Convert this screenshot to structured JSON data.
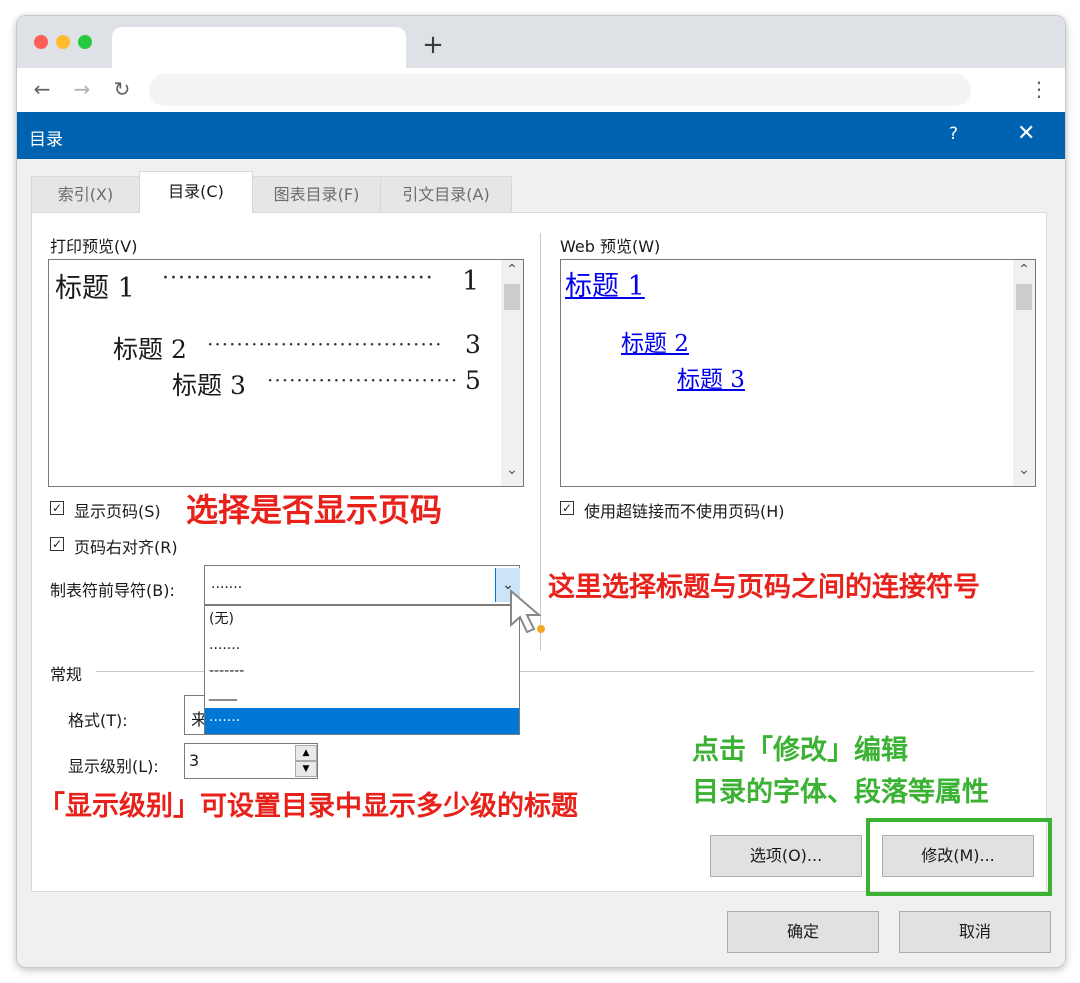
{
  "browser": {
    "new_tab_icon": "+",
    "back_icon": "←",
    "forward_icon": "→",
    "reload_icon": "↻",
    "menu_icon": "⋮"
  },
  "dialog": {
    "title": "目录",
    "help": "?",
    "close": "✕",
    "tabs": [
      "索引(X)",
      "目录(C)",
      "图表目录(F)",
      "引文目录(A)"
    ],
    "active_tab": 1,
    "print_preview": {
      "label": "打印预览(V)",
      "entries": [
        {
          "text": "标题 1",
          "page": "1"
        },
        {
          "text": "标题 2",
          "page": "3"
        },
        {
          "text": "标题 3",
          "page": "5"
        }
      ]
    },
    "web_preview": {
      "label": "Web 预览(W)",
      "entries": [
        "标题 1",
        "标题 2",
        "标题 3"
      ]
    },
    "checkboxes": {
      "show_page_numbers": {
        "label": "显示页码(S)",
        "checked": true
      },
      "right_align": {
        "label": "页码右对齐(R)",
        "checked": true
      },
      "use_hyperlinks": {
        "label": "使用超链接而不使用页码(H)",
        "checked": true
      }
    },
    "tab_leader": {
      "label": "制表符前导符(B):",
      "value": ".......",
      "options": [
        "(无)",
        ".......",
        "-------",
        "____",
        "·······"
      ],
      "selected_index": 4
    },
    "general": {
      "label": "常规",
      "format_label": "格式(T):",
      "format_value": "来",
      "levels_label": "显示级别(L):",
      "levels_value": "3"
    },
    "buttons": {
      "options": "选项(O)...",
      "modify": "修改(M)...",
      "ok": "确定",
      "cancel": "取消"
    }
  },
  "annotations": {
    "show_page_numbers": "选择是否显示页码",
    "leader": "这里选择标题与页码之间的连接符号",
    "modify_line1": "点击「修改」编辑",
    "modify_line2": "目录的字体、段落等属性",
    "levels": "「显示级别」可设置目录中显示多少级的标题"
  },
  "colors": {
    "title_bar": "#0063b1",
    "annotation_red": "#e8221b",
    "annotation_green": "#3bb233",
    "selection": "#0078d7"
  }
}
